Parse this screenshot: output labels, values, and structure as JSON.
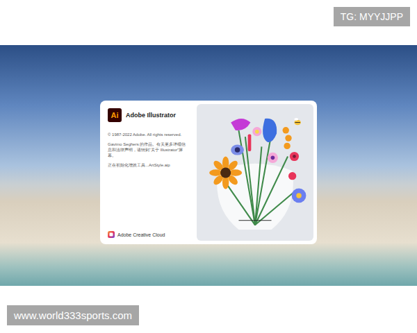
{
  "watermarks": {
    "top": "TG: MYYJJPP",
    "bottom": "www.world333sports.com"
  },
  "splash": {
    "logo": "Ai",
    "title": "Adobe Illustrator",
    "copyright": "© 1987-2022 Adobe. All rights reserved.",
    "credit": "Gavimo Seghers 的作品。有关更多详细信息和法律声明，请转到“关于 Illustrator”屏幕。",
    "status": "正在初始化增效工具...ArtStyle.aip",
    "footer": "Adobe Creative Cloud"
  }
}
